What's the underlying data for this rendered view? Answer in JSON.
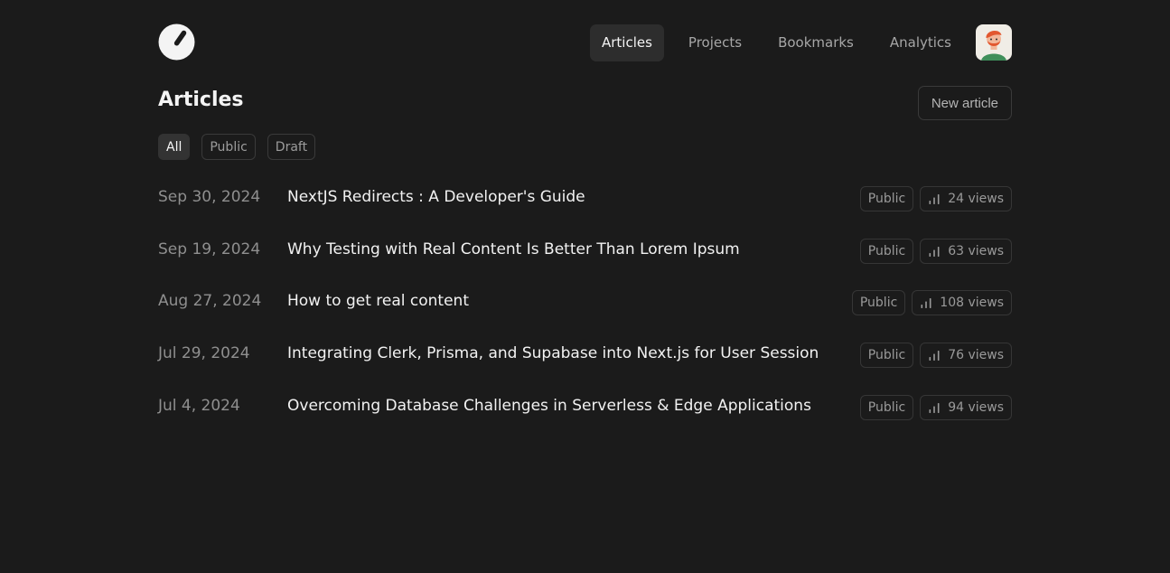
{
  "nav": {
    "items": [
      {
        "label": "Articles",
        "active": true
      },
      {
        "label": "Projects",
        "active": false
      },
      {
        "label": "Bookmarks",
        "active": false
      },
      {
        "label": "Analytics",
        "active": false
      }
    ]
  },
  "page": {
    "title": "Articles",
    "new_button": "New article"
  },
  "filters": [
    {
      "label": "All",
      "active": true
    },
    {
      "label": "Public",
      "active": false
    },
    {
      "label": "Draft",
      "active": false
    }
  ],
  "articles": [
    {
      "date": "Sep 30, 2024",
      "title": "NextJS Redirects : A Developer's Guide",
      "status": "Public",
      "views": "24 views"
    },
    {
      "date": "Sep 19, 2024",
      "title": "Why Testing with Real Content Is Better Than Lorem Ipsum",
      "status": "Public",
      "views": "63 views"
    },
    {
      "date": "Aug 27, 2024",
      "title": "How to get real content",
      "status": "Public",
      "views": "108 views"
    },
    {
      "date": "Jul 29, 2024",
      "title": "Integrating Clerk, Prisma, and Supabase into Next.js for User Session",
      "status": "Public",
      "views": "76 views"
    },
    {
      "date": "Jul 4, 2024",
      "title": "Overcoming Database Challenges in Serverless & Edge Applications",
      "status": "Public",
      "views": "94 views"
    }
  ],
  "icons": {
    "logo": "gauge-logo-icon",
    "views": "bar-chart-icon",
    "avatar": "user-avatar"
  },
  "colors": {
    "background": "#1b1b1b",
    "active_tab": "#2d2d2d",
    "border": "#3a3a3a",
    "text_primary": "#f2f2f2",
    "text_muted": "#8f8f8f"
  }
}
